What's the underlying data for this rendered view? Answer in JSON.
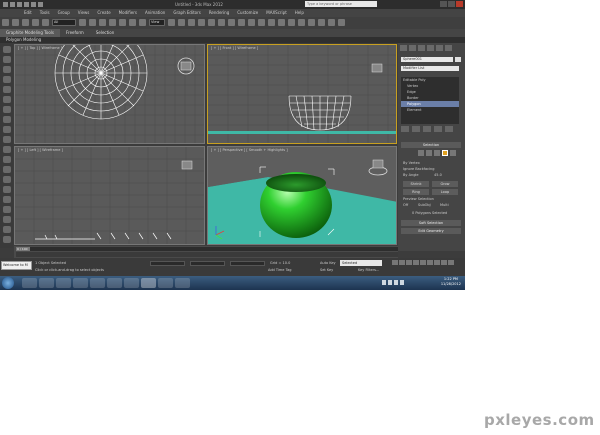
{
  "window": {
    "title": "Untitled - 3ds Max 2012",
    "search_placeholder": "Type a keyword or phrase"
  },
  "menu": [
    "Edit",
    "Tools",
    "Group",
    "Views",
    "Create",
    "Modifiers",
    "Animation",
    "Graph Editors",
    "Rendering",
    "Customize",
    "MAXScript",
    "Help"
  ],
  "toolbar": {
    "selection_filter": "All",
    "view_dropdown": "View"
  },
  "ribbon": {
    "tabs": [
      "Graphite Modeling Tools",
      "Freeform",
      "Selection"
    ],
    "sub_label": "Polygon Modeling"
  },
  "viewports": {
    "top": "[ + ] [ Top ] [ Wireframe ]",
    "front": "[ + ] [ Front ] [ Wireframe ]",
    "left": "[ + ] [ Left ] [ Wireframe ]",
    "perspective": "[ + ] [ Perspective ] [ Smooth + Highlights ]"
  },
  "command_panel": {
    "object_name": "Sphere001",
    "modifier_list": "Modifier List",
    "stack": [
      {
        "label": "Editable Poly",
        "level": "top"
      },
      {
        "label": "Vertex",
        "level": "sub"
      },
      {
        "label": "Edge",
        "level": "sub"
      },
      {
        "label": "Border",
        "level": "sub"
      },
      {
        "label": "Polygon",
        "level": "sub",
        "selected": true
      },
      {
        "label": "Element",
        "level": "sub"
      }
    ],
    "selection_rollout": "Selection",
    "options": {
      "by_vertex": "By Vertex",
      "ignore_backfacing": "Ignore Backfacing",
      "by_angle": "By Angle",
      "angle_value": "45.0",
      "shrink": "Shrink",
      "grow": "Grow",
      "ring": "Ring",
      "loop": "Loop",
      "preview_selection": "Preview Selection",
      "off": "Off",
      "subobj": "SubObj",
      "multi": "Multi",
      "polygons_selected": "0 Polygons Selected"
    },
    "soft_selection": "Soft Selection",
    "edit_geometry": "Edit Geometry"
  },
  "timeline": {
    "frame": "0 / 100",
    "ticks": [
      "0",
      "10",
      "20",
      "30",
      "40",
      "50",
      "60",
      "70",
      "80",
      "90",
      "100"
    ]
  },
  "status": {
    "welcome": "Welcome to M",
    "selected": "1 Object Selected",
    "prompt": "Click or click-and-drag to select objects",
    "grid": "Grid = 10.0",
    "add_time_tag": "Add Time Tag",
    "auto_key": "Auto Key",
    "set_key": "Set Key",
    "key_mode": "Selected",
    "key_filters": "Key Filters..."
  },
  "taskbar": {
    "time": "1:22 PM",
    "date": "11/28/2012"
  },
  "watermark": "pxleyes.com",
  "colors": {
    "ui_bg": "#3c3c3c",
    "viewport_bg": "#5a5a5a",
    "ground_cyan": "#3fb8a6",
    "bowl_green": "#20b020",
    "active_border": "#c8a020",
    "selection_blue": "#6b7fa8"
  }
}
